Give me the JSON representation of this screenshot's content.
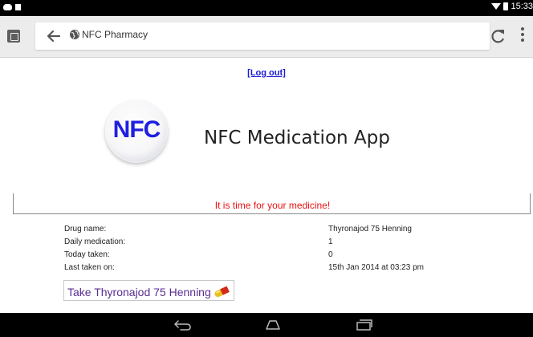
{
  "status_bar": {
    "time": "15:33",
    "icons": [
      "cloud-icon",
      "square-icon",
      "wifi-icon",
      "battery-icon"
    ]
  },
  "browser": {
    "url": "NFC Pharmacy",
    "icons": [
      "tab-switcher-icon",
      "back-arrow-icon",
      "globe-icon",
      "reload-icon",
      "overflow-menu-icon"
    ]
  },
  "page": {
    "logout_label": "[Log out]",
    "logo_text": "NFC",
    "app_title": "NFC Medication App",
    "alert": "It is time for your medicine!",
    "fields": {
      "drug_name_label": "Drug name:",
      "drug_name_value": "Thyronajod 75 Henning",
      "daily_label": "Daily medication:",
      "daily_value": "1",
      "today_label": "Today taken:",
      "today_value": "0",
      "last_label": "Last taken on:",
      "last_value": "15th Jan 2014 at 03:23 pm"
    },
    "take_button_label": "Take Thyronajod 75 Henning"
  },
  "colors": {
    "link": "#1a1ad6",
    "alert": "#ee1111",
    "logo_blue": "#1f1fe0",
    "button_text": "#5a2d91"
  },
  "nav_bar": {
    "icons": [
      "nav-back-icon",
      "nav-home-icon",
      "nav-recents-icon"
    ]
  }
}
